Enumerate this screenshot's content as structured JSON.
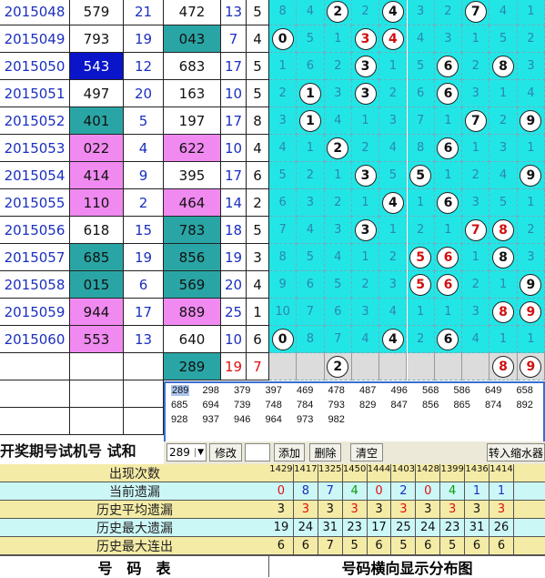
{
  "rows": [
    {
      "period": "2015048",
      "n1": "579",
      "s1": "21",
      "n2": "472",
      "s2": "13",
      "v": "5",
      "grid": [
        "8",
        "4",
        "(2)",
        "2",
        "(4)",
        "3",
        "2",
        "(7)",
        "4",
        "1"
      ]
    },
    {
      "period": "2015049",
      "n1": "793",
      "s1": "19",
      "n2": "043",
      "s2": "7",
      "v": "4",
      "grid": [
        "(0)",
        "5",
        "1",
        "(3r)",
        "(4r)",
        "4",
        "3",
        "1",
        "5",
        "2"
      ]
    },
    {
      "period": "2015050",
      "n1": "543",
      "s1": "12",
      "n2": "683",
      "s2": "17",
      "v": "5",
      "grid": [
        "1",
        "6",
        "2",
        "(3)",
        "1",
        "5",
        "(6)",
        "2",
        "(8)",
        "3"
      ]
    },
    {
      "period": "2015051",
      "n1": "497",
      "s1": "20",
      "n2": "163",
      "s2": "10",
      "v": "5",
      "grid": [
        "2",
        "(1)",
        "3",
        "(3)",
        "2",
        "6",
        "(6)",
        "3",
        "1",
        "4"
      ]
    },
    {
      "period": "2015052",
      "n1": "401",
      "s1": "5",
      "n2": "197",
      "s2": "17",
      "v": "8",
      "grid": [
        "3",
        "(1)",
        "4",
        "1",
        "3",
        "7",
        "1",
        "(7)",
        "2",
        "(9)"
      ]
    },
    {
      "period": "2015053",
      "n1": "022",
      "s1": "4",
      "n2": "622",
      "s2": "10",
      "v": "4",
      "grid": [
        "4",
        "1",
        "(2)",
        "2",
        "4",
        "8",
        "(6)",
        "1",
        "3",
        "1"
      ]
    },
    {
      "period": "2015054",
      "n1": "414",
      "s1": "9",
      "n2": "395",
      "s2": "17",
      "v": "6",
      "grid": [
        "5",
        "2",
        "1",
        "(3)",
        "5",
        "(5)",
        "1",
        "2",
        "4",
        "(9)"
      ]
    },
    {
      "period": "2015055",
      "n1": "110",
      "s1": "2",
      "n2": "464",
      "s2": "14",
      "v": "2",
      "grid": [
        "6",
        "3",
        "2",
        "1",
        "(4)",
        "1",
        "(6)",
        "3",
        "5",
        "1"
      ]
    },
    {
      "period": "2015056",
      "n1": "618",
      "s1": "15",
      "n2": "783",
      "s2": "18",
      "v": "5",
      "grid": [
        "7",
        "4",
        "3",
        "(3)",
        "1",
        "2",
        "1",
        "(7r)",
        "(8r)",
        "2"
      ]
    },
    {
      "period": "2015057",
      "n1": "685",
      "s1": "19",
      "n2": "856",
      "s2": "19",
      "v": "3",
      "grid": [
        "8",
        "5",
        "4",
        "1",
        "2",
        "(5r)",
        "(6r)",
        "1",
        "(8)",
        "3"
      ]
    },
    {
      "period": "2015058",
      "n1": "015",
      "s1": "6",
      "n2": "569",
      "s2": "20",
      "v": "4",
      "grid": [
        "9",
        "6",
        "5",
        "2",
        "3",
        "(5r)",
        "(6r)",
        "2",
        "1",
        "(9)"
      ]
    },
    {
      "period": "2015059",
      "n1": "944",
      "s1": "17",
      "n2": "889",
      "s2": "25",
      "v": "1",
      "grid": [
        "10",
        "7",
        "6",
        "3",
        "4",
        "1",
        "1",
        "3",
        "(8r)",
        "(9r)"
      ]
    },
    {
      "period": "2015060",
      "n1": "553",
      "s1": "13",
      "n2": "640",
      "s2": "10",
      "v": "6",
      "grid": [
        "(0)",
        "8",
        "7",
        "4",
        "(4)",
        "2",
        "(6)",
        "4",
        "1",
        "1"
      ]
    }
  ],
  "pending": {
    "n2": "289",
    "s2": "19",
    "v": "7",
    "balls": [
      {
        "col": 2,
        "label": "2",
        "red": false
      },
      {
        "col": 8,
        "label": "8",
        "red": true
      },
      {
        "col": 9,
        "label": "9",
        "red": true
      }
    ]
  },
  "candidates": [
    [
      "289",
      "298",
      "379",
      "397",
      "469",
      "478",
      "487",
      "496",
      "568",
      "586",
      "649",
      "658"
    ],
    [
      "685",
      "694",
      "739",
      "748",
      "784",
      "793",
      "829",
      "847",
      "856",
      "865",
      "874",
      "892"
    ],
    [
      "928",
      "937",
      "946",
      "964",
      "973",
      "982"
    ]
  ],
  "col_headers": {
    "left_label": "开奖期号试机号 试和"
  },
  "toolbar": {
    "select_value": "289",
    "modify": "修改",
    "add": "添加",
    "delete": "删除",
    "clear": "清空",
    "shrink": "转入缩水器"
  },
  "stats": [
    {
      "label": "出现次数",
      "values": [
        "1429",
        "1417",
        "1325",
        "1450",
        "1444",
        "1403",
        "1428",
        "1399",
        "1436",
        "1414"
      ],
      "bg": "#f4eba6"
    },
    {
      "label": "当前遗漏",
      "values": [
        "0",
        "8",
        "7",
        "4",
        "0",
        "2",
        "0",
        "4",
        "1",
        "1"
      ],
      "bg": "#ccf7f7"
    },
    {
      "label": "历史平均遗漏",
      "values": [
        "3",
        "3",
        "3",
        "3",
        "3",
        "3",
        "3",
        "3",
        "3",
        "3"
      ],
      "bg": "#f4eba6"
    },
    {
      "label": "历史最大遗漏",
      "values": [
        "19",
        "24",
        "31",
        "23",
        "17",
        "25",
        "24",
        "23",
        "31",
        "26"
      ],
      "bg": "#ccf7f7"
    },
    {
      "label": "历史最大连出",
      "values": [
        "6",
        "6",
        "7",
        "5",
        "6",
        "5",
        "6",
        "5",
        "6",
        "6"
      ],
      "bg": "#f4eba6"
    }
  ],
  "footer": {
    "left": "号　码　表",
    "right": "号码横向显示分布图"
  }
}
